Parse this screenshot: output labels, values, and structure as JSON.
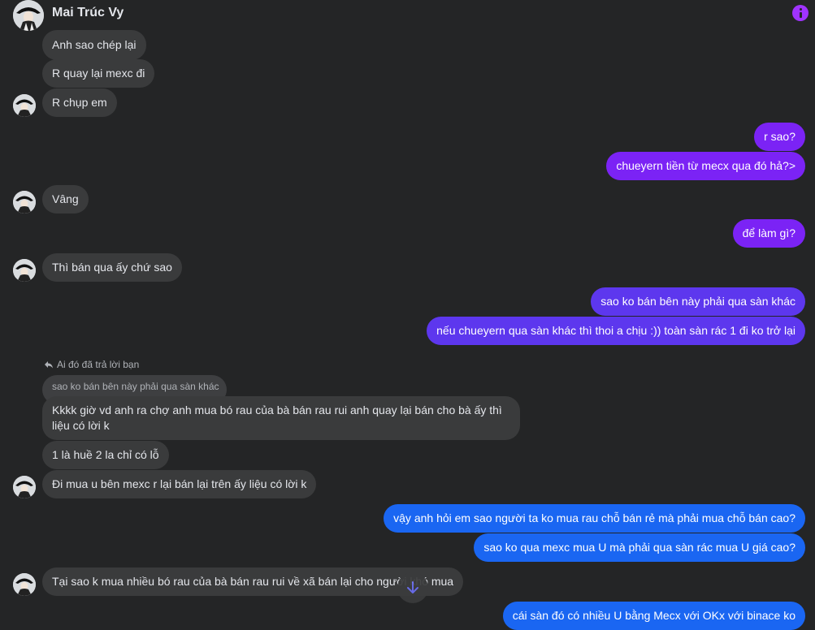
{
  "header": {
    "contact_name": "Mai Trúc Vy",
    "avatar_icon": "user-avatar",
    "info_icon": "info-icon",
    "accent_color": "#a033ff"
  },
  "messages": [
    {
      "from": "contact",
      "text": "Anh sao chép lại"
    },
    {
      "from": "contact",
      "text": "R quay lại mexc đi"
    },
    {
      "from": "contact",
      "text": "R chụp em"
    },
    {
      "from": "me",
      "text": "r sao?"
    },
    {
      "from": "me",
      "text": "chueyern tiền từ mecx qua đó hả?>"
    },
    {
      "from": "contact",
      "text": "Vâng"
    },
    {
      "from": "me",
      "text": "để làm gì?"
    },
    {
      "from": "contact",
      "text": "Thì bán qua ấy chứ sao"
    },
    {
      "from": "me",
      "text": "sao ko bán bên này phải qua sàn khác"
    },
    {
      "from": "me",
      "text": "nếu chueyern qua sàn khác thì thoi a chịu :)) toàn sàn rác  1 đi ko trở lại"
    },
    {
      "from": "contact",
      "text": "Kkkk giờ vd anh ra chợ anh mua bó rau của bà bán rau rui anh quay lại bán cho bà ấy thì liệu có lời k"
    },
    {
      "from": "contact",
      "text": "1 là huề 2 la chỉ có lỗ"
    },
    {
      "from": "contact",
      "text": "Đi mua u bên mexc r lại bán lại trên ấy liệu có lời k"
    },
    {
      "from": "me",
      "text": "vậy anh hỏi em sao người ta ko mua rau chỗ bán rẻ mà phải mua chỗ bán cao?"
    },
    {
      "from": "me",
      "text": "sao ko qua mexc mua U mà phải qua sàn rác mua U giá cao?"
    },
    {
      "from": "contact",
      "text": "Tại sao k mua nhiều bó rau của bà bán rau rui về xã bán lại cho người   khó mua"
    },
    {
      "from": "me",
      "text": "cái sàn đó có nhiều U bằng Mecx với OKx với binace ko"
    }
  ],
  "reply": {
    "label": "Ai đó đã trả lời bạn",
    "quoted_text": "sao ko bán bên này phải qua sàn khác",
    "icon": "reply-arrow-icon"
  },
  "scroll_button": {
    "icon": "arrow-down-icon"
  },
  "colors": {
    "background": "#242526",
    "incoming_bubble": "#3a3b3c",
    "outgoing_purple": "#7b23f5",
    "outgoing_violet": "#5d37ee",
    "outgoing_blue": "#1a66f2"
  }
}
